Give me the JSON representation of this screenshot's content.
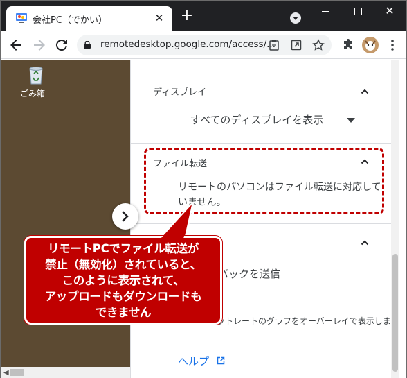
{
  "browser": {
    "tab_title": "会社PC（でかい）",
    "tab_close": "✕",
    "new_tab": "+",
    "url": "remotedesktop.google.com/access/...",
    "window_close": "✕"
  },
  "desktop": {
    "recycle_bin_label": "ごみ箱"
  },
  "panel": {
    "display_section_title": "ディスプレイ",
    "display_select_value": "すべてのディスプレイを表示",
    "file_transfer_title": "ファイル転送",
    "file_transfer_message": "リモートのパソコンはファイル転送に対応していません。",
    "feedback_label": "バックを送信",
    "overlay_label": "ットレートのグラフをオーバーレイで表示します",
    "help_link": "ヘルプ"
  },
  "callout": {
    "text": "リモートPCでファイル転送が\n禁止（無効化）されていると、\nこのように表示されて、\nアップロードもダウンロードも\nできません"
  },
  "colors": {
    "accent": "#1a73e8",
    "callout": "#c00000",
    "desktop": "#5c4a32"
  }
}
